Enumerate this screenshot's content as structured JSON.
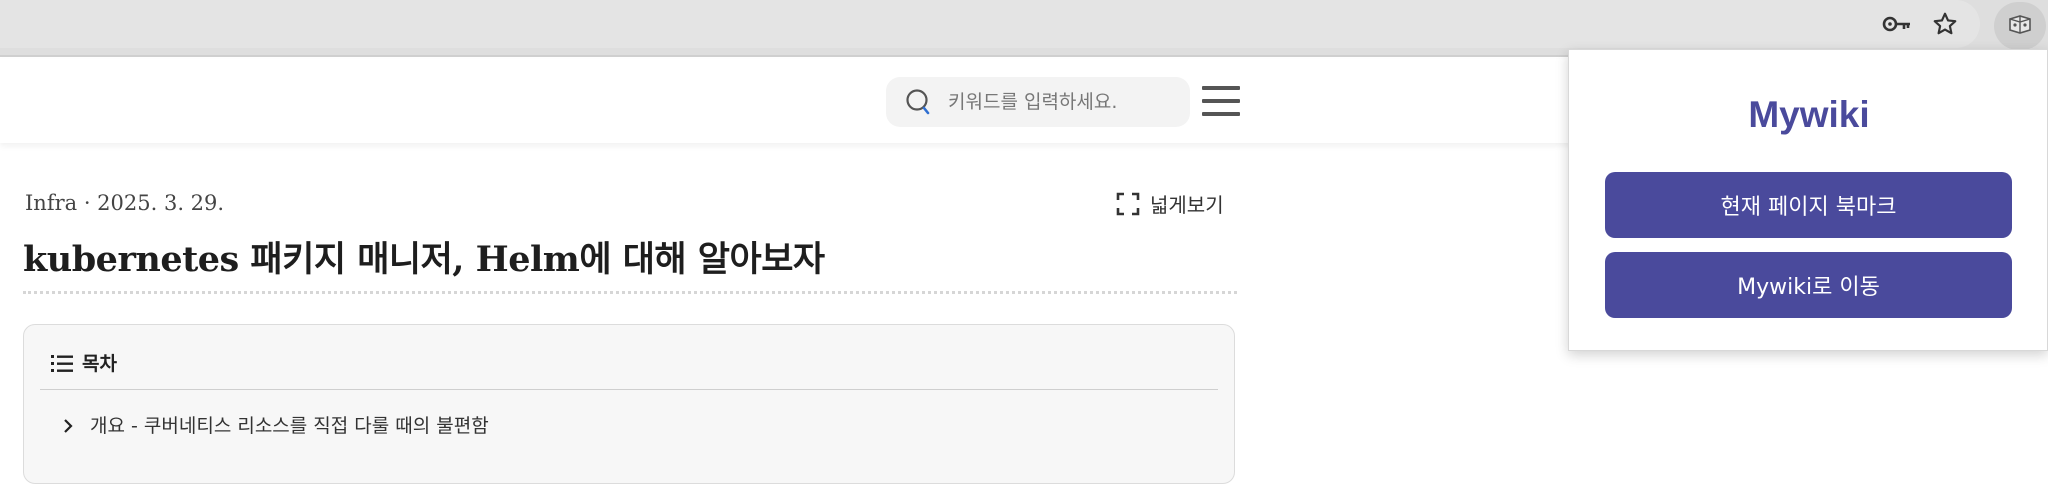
{
  "browser": {
    "toolbar_icons": [
      "key-icon",
      "star-icon",
      "extension-icon"
    ]
  },
  "site": {
    "search": {
      "placeholder": "키워드를 입력하세요."
    },
    "menu_icon": "hamburger-menu-icon"
  },
  "article": {
    "meta": "Infra · 2025. 3. 29.",
    "expand_label": "넓게보기",
    "title": "kubernetes 패키지 매니저, Helm에 대해 알아보자",
    "toc": {
      "heading": "목차",
      "items": [
        {
          "label": "개요 - 쿠버네티스 리소스를 직접 다룰 때의 불편함"
        }
      ]
    }
  },
  "popup": {
    "title": "Mywiki",
    "buttons": [
      {
        "label": "현재 페이지 북마크"
      },
      {
        "label": "Mywiki로 이동"
      }
    ],
    "accent_color": "#4a4a9c"
  }
}
